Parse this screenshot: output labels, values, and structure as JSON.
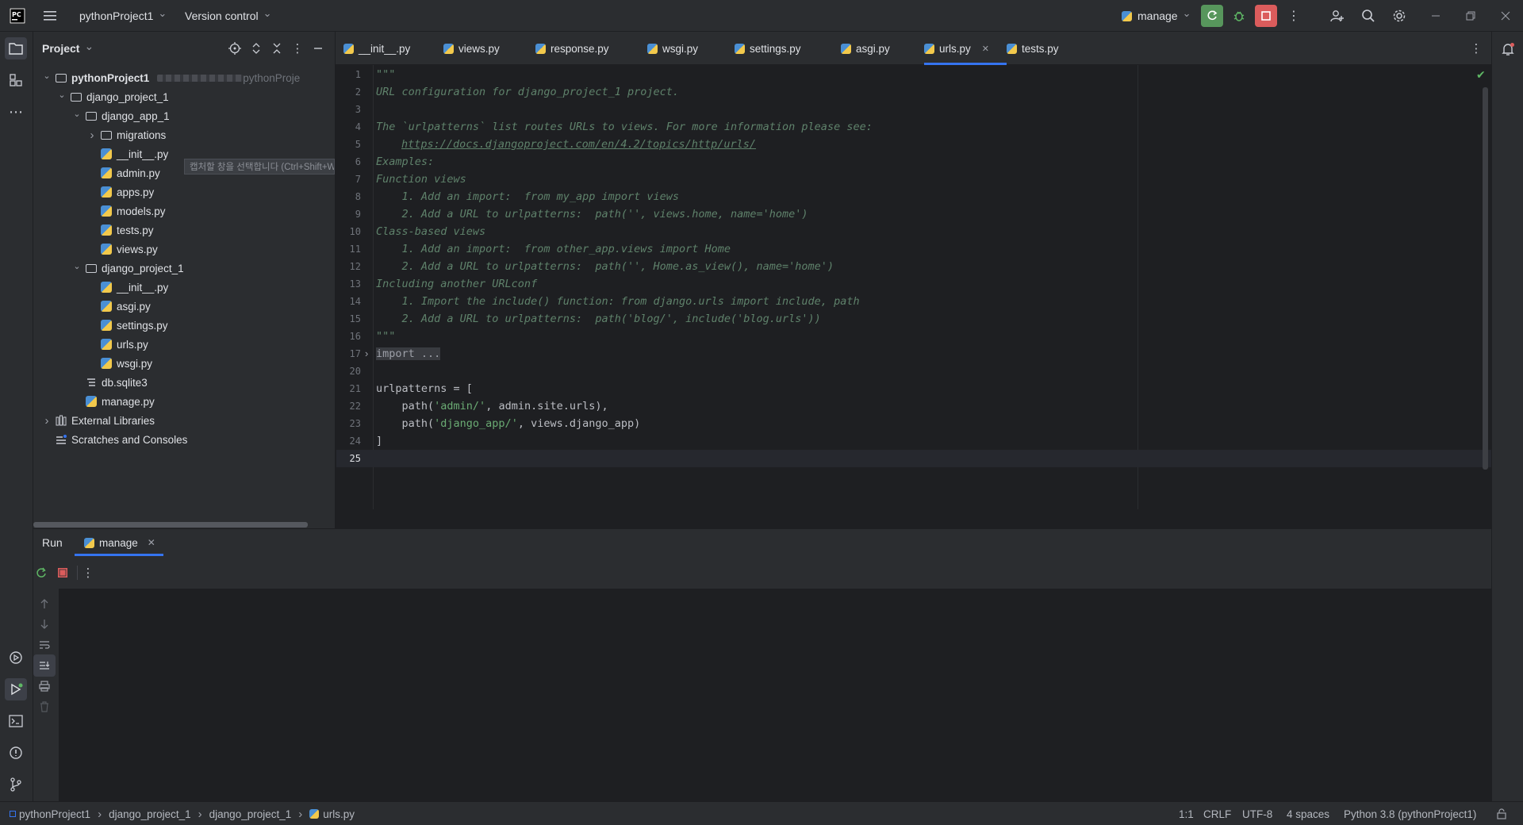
{
  "titlebar": {
    "project_name": "pythonProject1",
    "vcs_label": "Version control",
    "run_config": "manage"
  },
  "project_panel": {
    "title": "Project",
    "tooltip": "캡처할 창을 선택합니다 (Ctrl+Shift+W)",
    "tree": [
      {
        "label": "pythonProject1",
        "suffix": "pythonProje",
        "type": "folder",
        "depth": 0,
        "expanded": true
      },
      {
        "label": "django_project_1",
        "type": "folder",
        "depth": 1,
        "expanded": true
      },
      {
        "label": "django_app_1",
        "type": "package",
        "depth": 2,
        "expanded": true
      },
      {
        "label": "migrations",
        "type": "package",
        "depth": 3,
        "expanded": false
      },
      {
        "label": "__init__.py",
        "type": "py",
        "depth": 3
      },
      {
        "label": "admin.py",
        "type": "py",
        "depth": 3
      },
      {
        "label": "apps.py",
        "type": "py",
        "depth": 3
      },
      {
        "label": "models.py",
        "type": "py",
        "depth": 3
      },
      {
        "label": "tests.py",
        "type": "py",
        "depth": 3
      },
      {
        "label": "views.py",
        "type": "py",
        "depth": 3
      },
      {
        "label": "django_project_1",
        "type": "package",
        "depth": 2,
        "expanded": true
      },
      {
        "label": "__init__.py",
        "type": "py",
        "depth": 3
      },
      {
        "label": "asgi.py",
        "type": "py",
        "depth": 3
      },
      {
        "label": "settings.py",
        "type": "py",
        "depth": 3
      },
      {
        "label": "urls.py",
        "type": "py",
        "depth": 3
      },
      {
        "label": "wsgi.py",
        "type": "py",
        "depth": 3
      },
      {
        "label": "db.sqlite3",
        "type": "db",
        "depth": 2
      },
      {
        "label": "manage.py",
        "type": "py",
        "depth": 2
      },
      {
        "label": "External Libraries",
        "type": "lib",
        "depth": 0,
        "expanded": false
      },
      {
        "label": "Scratches and Consoles",
        "type": "scratch",
        "depth": 0
      }
    ]
  },
  "tabs": [
    {
      "label": "__init__.py"
    },
    {
      "label": "views.py"
    },
    {
      "label": "response.py"
    },
    {
      "label": "wsgi.py"
    },
    {
      "label": "settings.py"
    },
    {
      "label": "asgi.py"
    },
    {
      "label": "urls.py",
      "active": true
    },
    {
      "label": "tests.py"
    }
  ],
  "code": {
    "line_numbers": [
      "1",
      "2",
      "3",
      "4",
      "5",
      "6",
      "7",
      "8",
      "9",
      "10",
      "11",
      "12",
      "13",
      "14",
      "15",
      "16",
      "17",
      "20",
      "21",
      "22",
      "23",
      "24",
      "25"
    ],
    "lines": [
      "\"\"\"",
      "URL configuration for django_project_1 project.",
      "",
      "The `urlpatterns` list routes URLs to views. For more information please see:",
      "https://docs.djangoproject.com/en/4.2/topics/http/urls/",
      "Examples:",
      "Function views",
      "    1. Add an import:  from my_app import views",
      "    2. Add a URL to urlpatterns:  path('', views.home, name='home')",
      "Class-based views",
      "    1. Add an import:  from other_app.views import Home",
      "    2. Add a URL to urlpatterns:  path('', Home.as_view(), name='home')",
      "Including another URLconf",
      "    1. Import the include() function: from django.urls import include, path",
      "    2. Add a URL to urlpatterns:  path('blog/', include('blog.urls'))",
      "\"\"\"",
      "import ...",
      "",
      "urlpatterns = [",
      "    path(",
      "'admin/'",
      ", admin.site.urls),",
      "    path(",
      "'django_app/'",
      ", views.django_app)",
      "]"
    ]
  },
  "run_panel": {
    "title": "Run",
    "tab_label": "manage"
  },
  "statusbar": {
    "breadcrumb": [
      "pythonProject1",
      "django_project_1",
      "django_project_1",
      "urls.py"
    ],
    "position": "1:1",
    "line_sep": "CRLF",
    "encoding": "UTF-8",
    "indent": "4 spaces",
    "interpreter": "Python 3.8 (pythonProject1)"
  },
  "colors": {
    "accent": "#3574f0",
    "run_green": "#57965c",
    "stop_red": "#db5c5c"
  }
}
